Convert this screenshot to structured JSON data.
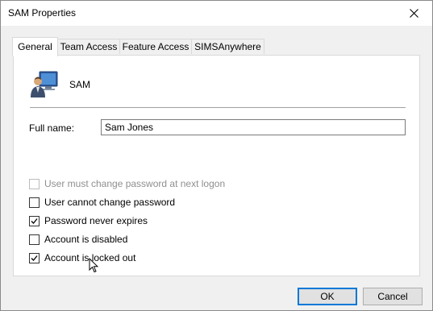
{
  "window": {
    "title": "SAM Properties"
  },
  "tabs": [
    {
      "label": "General",
      "active": true
    },
    {
      "label": "Team Access",
      "active": false
    },
    {
      "label": "Feature Access",
      "active": false
    },
    {
      "label": "SIMSAnywhere",
      "active": false
    }
  ],
  "general": {
    "user_name": "SAM",
    "user_icon": "user-computer-icon",
    "full_name_label": "Full name:",
    "full_name_value": "Sam Jones",
    "options": [
      {
        "label": "User must change password at next logon",
        "checked": false,
        "disabled": true
      },
      {
        "label": "User cannot change password",
        "checked": false,
        "disabled": false
      },
      {
        "label": "Password never expires",
        "checked": true,
        "disabled": false
      },
      {
        "label": "Account is disabled",
        "checked": false,
        "disabled": false
      },
      {
        "label": "Account is locked out",
        "checked": true,
        "disabled": false
      }
    ]
  },
  "buttons": {
    "ok": "OK",
    "cancel": "Cancel"
  },
  "colors": {
    "accent": "#0078d7",
    "dialog_bg": "#f0f0f0",
    "panel_bg": "#ffffff",
    "disabled_text": "#8f8f8f"
  }
}
